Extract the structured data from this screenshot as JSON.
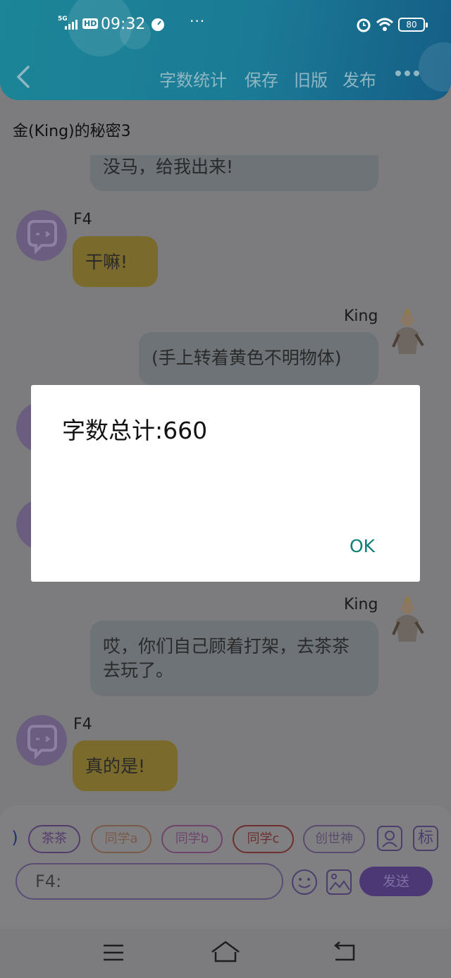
{
  "status_bar": {
    "signal": "5G",
    "hd": "HD",
    "time": "09:32",
    "more": "···",
    "battery": "80"
  },
  "nav": {
    "actions": [
      "字数统计",
      "保存",
      "旧版",
      "发布"
    ]
  },
  "doc_title": "金(King)的秘密3",
  "messages": [
    {
      "sender": "",
      "side": "left",
      "text": "没马，给我出来!"
    },
    {
      "sender": "F4",
      "side": "left",
      "text": "干嘛!"
    },
    {
      "sender": "King",
      "side": "right",
      "text": "(手上转着黄色不明物体)"
    },
    {
      "sender": "King",
      "side": "right",
      "text": "哎，你们自己顾着打架，去茶茶去玩了。"
    },
    {
      "sender": "F4",
      "side": "left",
      "text": "真的是!"
    }
  ],
  "chips": [
    ")",
    "茶茶",
    "同学a",
    "同学b",
    "同学c",
    "创世神"
  ],
  "role_tag": "标",
  "input": {
    "value": "F4:"
  },
  "send_label": "发送",
  "dialog": {
    "message": "字数总计:660",
    "ok_label": "OK"
  },
  "colors": {
    "header": "#1b7b96",
    "accent_purple": "#4b3875",
    "dialog_ok": "#0b7f78"
  }
}
